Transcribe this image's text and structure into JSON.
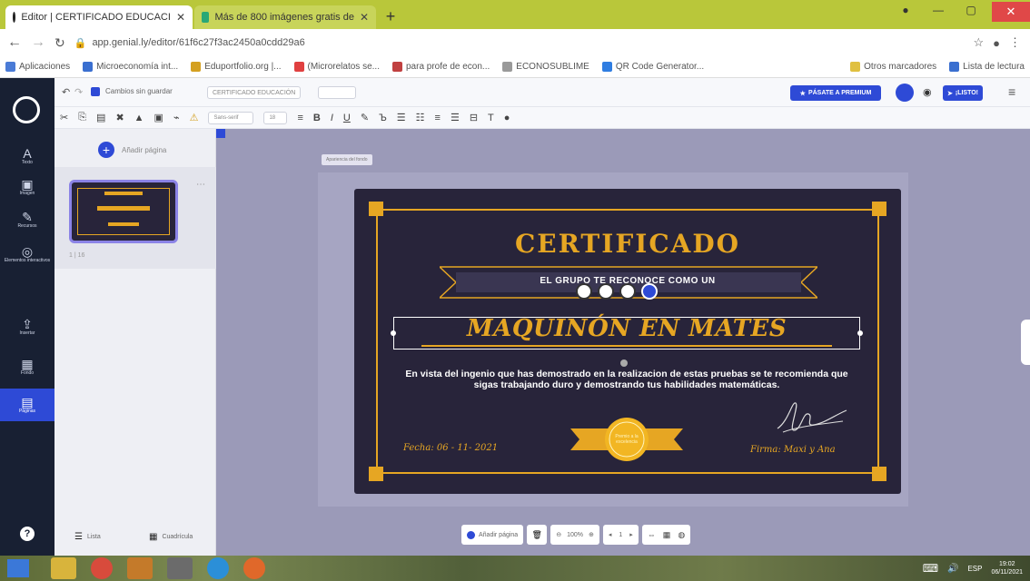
{
  "browser": {
    "tabs": [
      {
        "title": "Editor | CERTIFICADO EDUCACI",
        "active": true
      },
      {
        "title": "Más de 800 imágenes gratis de",
        "active": false
      }
    ],
    "url": "app.genial.ly/editor/61f6c27f3ac2450a0cdd29a6",
    "bookmarks": [
      "Aplicaciones",
      "Microeconomía int...",
      "Eduportfolio.org |...",
      "(Microrelatos se...",
      "para profe de econ...",
      "ECONOSUBLIME",
      "QR Code Generator...",
      "Otros marcadores",
      "Lista de lectura"
    ],
    "bookmark_colors": [
      "#4a7bd6",
      "#3a6fd0",
      "#d4a020",
      "#e04040",
      "#c04040",
      "#999999",
      "#2f7de1",
      "#e0c040",
      "#3a6fd0"
    ]
  },
  "leftnav": {
    "items": [
      {
        "label": "Texto",
        "icon": "text-icon"
      },
      {
        "label": "Imagen",
        "icon": "image-icon"
      },
      {
        "label": "Recursos",
        "icon": "resources-icon"
      },
      {
        "label": "Elementos interactivos",
        "icon": "interactive-icon"
      },
      {
        "label": "Insertar",
        "icon": "insert-icon"
      },
      {
        "label": "Fondo",
        "icon": "background-icon"
      },
      {
        "label": "Páginas",
        "icon": "pages-icon"
      }
    ]
  },
  "toolbar": {
    "save_status": "Cambios sin guardar",
    "doc_title": "CERTIFICADO EDUCACIÓN",
    "premium_label": "PÁSATE A PREMIUM",
    "all_label": "¡LISTO!"
  },
  "format": {
    "font_family": "Sans-serif",
    "font_size": "18"
  },
  "panel": {
    "add_page": "Añadir página",
    "page_number": "1 | 16",
    "view_list": "Lista",
    "view_grid": "Cuadrícula"
  },
  "canvas": {
    "appearance": "Apariencia del fondo",
    "bottom": {
      "add_page": "Añadir página",
      "zoom": "100%",
      "page": "1"
    }
  },
  "certificate": {
    "title": "CERTIFICADO",
    "ribbon": "EL GRUPO TE RECONOCE COMO UN",
    "name": "MAQUINÓN EN MATES",
    "body": "En vista del ingenio que has demostrado en la realizacion de estas pruebas se te recomienda que sigas trabajando duro y demostrando tus habilidades matemáticas.",
    "date": "Fecha: 06 - 11- 2021",
    "signature": "Firma: Maxi y Ana",
    "seal_text": "Premio a la excelencia"
  },
  "taskbar": {
    "lang": "ESP",
    "time": "19:02",
    "date": "06/11/2021"
  }
}
